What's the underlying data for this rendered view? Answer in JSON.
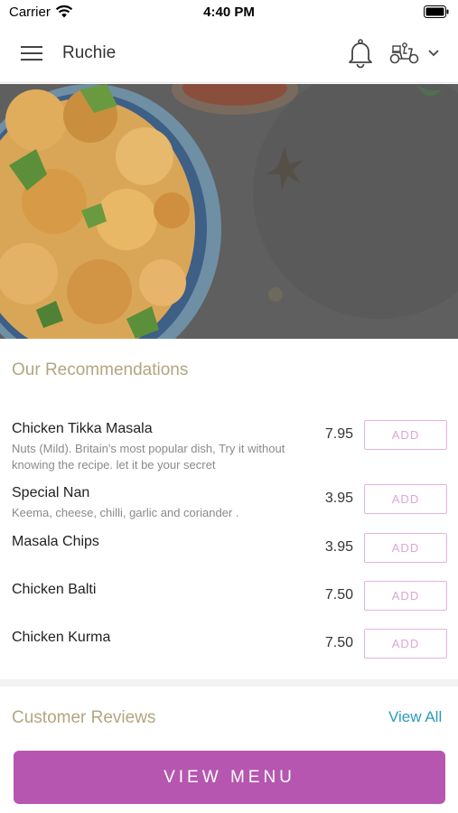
{
  "status_bar": {
    "carrier": "Carrier",
    "time": "4:40 PM"
  },
  "header": {
    "title": "Ruchie"
  },
  "icons": {
    "menu": "hamburger-icon",
    "notifications": "bell-icon",
    "delivery": "scooter-icon",
    "dropdown": "chevron-down-icon"
  },
  "recommendations": {
    "title": "Our Recommendations",
    "items": [
      {
        "name": "Chicken Tikka Masala",
        "desc_line1": "Nuts (Mild). Britain's most popular dish, Try it without",
        "desc_line2": "knowing the recipe. let it be your secret",
        "price": "7.95",
        "button": "ADD"
      },
      {
        "name": "Special Nan",
        "desc_line1": "Keema, cheese, chilli, garlic and coriander .",
        "desc_line2": "",
        "price": "3.95",
        "button": "ADD"
      },
      {
        "name": "Masala Chips",
        "desc_line1": "",
        "desc_line2": "",
        "price": "3.95",
        "button": "ADD"
      },
      {
        "name": "Chicken Balti",
        "desc_line1": "",
        "desc_line2": "",
        "price": "7.50",
        "button": "ADD"
      },
      {
        "name": "Chicken Kurma",
        "desc_line1": "",
        "desc_line2": "",
        "price": "7.50",
        "button": "ADD"
      }
    ]
  },
  "reviews": {
    "title": "Customer Reviews",
    "view_all": "View All"
  },
  "footer": {
    "view_menu": "VIEW MENU"
  },
  "colors": {
    "accent": "#b656b1",
    "section_title": "#b2a67f",
    "link": "#2a9bbd",
    "add_border": "#e2b3e0"
  }
}
